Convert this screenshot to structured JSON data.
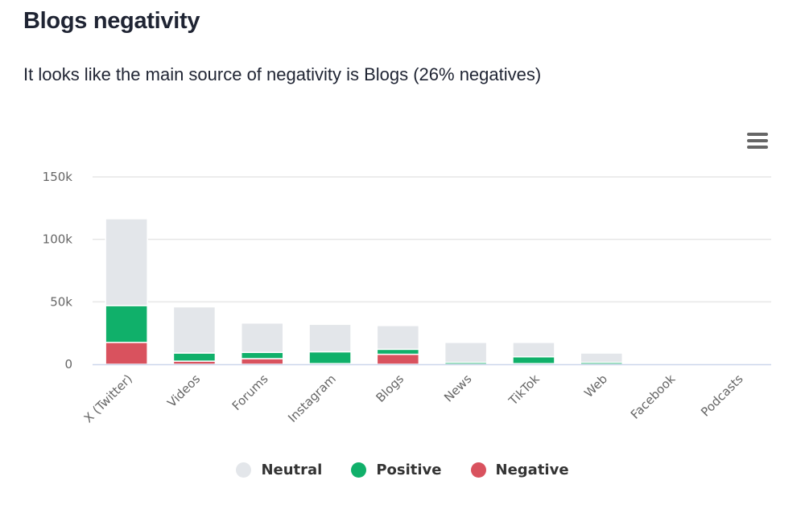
{
  "header": {
    "title": "Blogs negativity",
    "subtitle": "It looks like the main source of negativity is Blogs (26% negatives)"
  },
  "menu": {
    "icon": "hamburger-menu-icon"
  },
  "chart_data": {
    "type": "bar",
    "stacked": true,
    "title": "",
    "xlabel": "",
    "ylabel": "",
    "ylim": [
      0,
      150000
    ],
    "yticks": [
      0,
      50000,
      100000,
      150000
    ],
    "ytick_labels": [
      "0",
      "50k",
      "100k",
      "150k"
    ],
    "grid": true,
    "legend_position": "bottom-center",
    "categories": [
      "X (Twitter)",
      "Videos",
      "Forums",
      "Instagram",
      "Blogs",
      "News",
      "TikTok",
      "Web",
      "Facebook",
      "Podcasts"
    ],
    "series": [
      {
        "name": "Neutral",
        "color": "#e3e6ea",
        "values": [
          69500,
          37000,
          23500,
          22000,
          19000,
          16000,
          11500,
          7500,
          0,
          0
        ]
      },
      {
        "name": "Positive",
        "color": "#10b06a",
        "values": [
          29500,
          6500,
          5000,
          9500,
          4000,
          1500,
          5500,
          1500,
          0,
          0
        ]
      },
      {
        "name": "Negative",
        "color": "#d9525e",
        "values": [
          17500,
          2500,
          4500,
          500,
          8000,
          0,
          500,
          0,
          0,
          0
        ]
      }
    ]
  },
  "legend": {
    "items": [
      {
        "label": "Neutral",
        "color": "#e3e6ea"
      },
      {
        "label": "Positive",
        "color": "#10b06a"
      },
      {
        "label": "Negative",
        "color": "#d9525e"
      }
    ]
  }
}
